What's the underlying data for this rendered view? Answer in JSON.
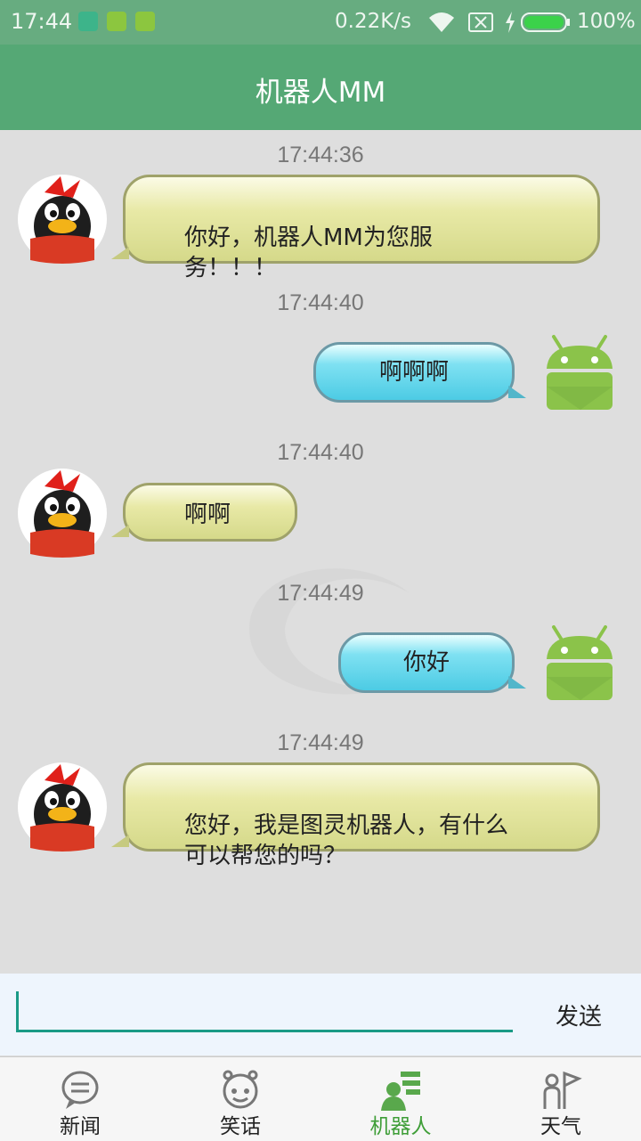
{
  "status_bar": {
    "time": "17:44",
    "net_speed": "0.22K/s",
    "battery": "100%"
  },
  "header": {
    "title": "机器人MM"
  },
  "messages": [
    {
      "side": "left",
      "time": "17:44:36",
      "text": "你好，机器人MM为您服\n务！！！"
    },
    {
      "side": "right",
      "time": "17:44:40",
      "text": "啊啊啊"
    },
    {
      "side": "left",
      "time": "17:44:40",
      "text": "啊啊"
    },
    {
      "side": "right",
      "time": "17:44:49",
      "text": "你好"
    },
    {
      "side": "left",
      "time": "17:44:49",
      "text": "您好，我是图灵机器人，有什么\n可以帮您的吗？"
    }
  ],
  "composer": {
    "value": "",
    "send_label": "发送"
  },
  "tabs": [
    {
      "label": "新闻",
      "icon": "chat-bubble-icon",
      "active": false
    },
    {
      "label": "笑话",
      "icon": "joke-face-icon",
      "active": false
    },
    {
      "label": "机器人",
      "icon": "robot-person-icon",
      "active": true
    },
    {
      "label": "天气",
      "icon": "weather-flag-icon",
      "active": false
    }
  ],
  "colors": {
    "status_bar": "#67ac80",
    "app_bar": "#55a875",
    "accent": "#1a9a86",
    "active_tab": "#3f9e38"
  }
}
